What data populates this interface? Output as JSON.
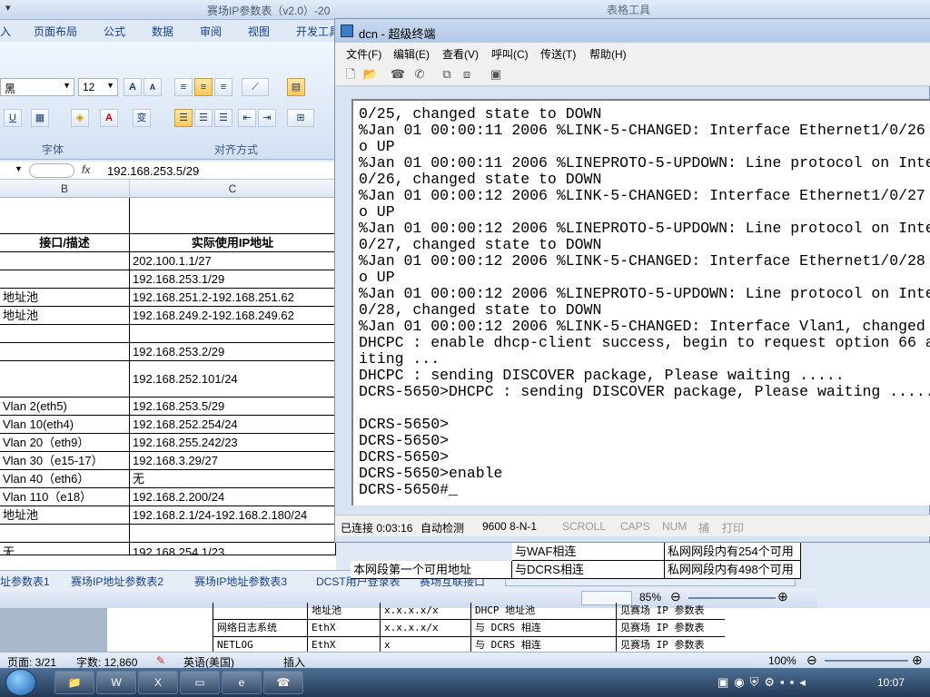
{
  "excel": {
    "title": "赛场IP参数表（v2.0）-20",
    "title_right": "表格工具",
    "quick_access": "▾",
    "ribbon_tabs": [
      "入",
      "页面布局",
      "公式",
      "数据",
      "审阅",
      "视图",
      "开发工具"
    ],
    "font_name": "黑",
    "font_size": "12",
    "group_font": "字体",
    "group_align": "对齐方式",
    "formula_fx": "fx",
    "formula_value": "192.168.253.5/29",
    "columns": [
      "B",
      "C"
    ],
    "header_b": "接口/描述",
    "header_c": "实际使用IP地址",
    "rows": [
      {
        "b": "",
        "c": "202.100.1.1/27"
      },
      {
        "b": "",
        "c": "192.168.253.1/29"
      },
      {
        "b": "地址池",
        "c": "192.168.251.2-192.168.251.62"
      },
      {
        "b": "地址池",
        "c": "192.168.249.2-192.168.249.62"
      },
      {
        "b": "",
        "c": ""
      },
      {
        "b": "",
        "c": "192.168.253.2/29"
      },
      {
        "b": "",
        "c": "192.168.252.101/24"
      },
      {
        "b": "Vlan 2(eth5)",
        "c": "192.168.253.5/29"
      },
      {
        "b": "Vlan 10(eth4)",
        "c": "192.168.252.254/24"
      },
      {
        "b": "Vlan 20（eth9）",
        "c": "192.168.255.242/23"
      },
      {
        "b": "Vlan 30（e15-17）",
        "c": "192.168.3.29/27"
      },
      {
        "b": "Vlan 40（eth6）",
        "c": "无"
      },
      {
        "b": "Vlan 110（e18）",
        "c": "192.168.2.200/24"
      },
      {
        "b": "地址池",
        "c": "192.168.2.1/24-192.168.2.180/24"
      },
      {
        "b": "",
        "c": ""
      }
    ],
    "bottom_row": {
      "b": "无",
      "c": "192.168.254.1/23",
      "d": "本网段第一个可用地址",
      "e": "与WAF相连",
      "f": "私网网段内有254个可用"
    },
    "bottom_row2": {
      "e": "与DCRS相连",
      "f": "私网网段内有498个可用"
    },
    "sheet_tabs": [
      "址参数表1",
      "赛场IP地址参数表2",
      "赛场IP地址参数表3",
      "DCST用户登录表",
      "赛场互联接口"
    ],
    "zoom": "85%"
  },
  "word": {
    "table_rows": [
      {
        "a": "",
        "b": "地址池",
        "c": "x.x.x.x/x",
        "d": "DHCP 地址池",
        "e": "见赛场 IP 参数表"
      },
      {
        "a": "网络日志系统",
        "b": "EthX",
        "c": "x.x.x.x/x",
        "d": "与 DCRS 相连",
        "e": "见赛场 IP 参数表"
      },
      {
        "a": "NETLOG",
        "b": "EthX",
        "c": "x",
        "d": "与 DCRS 相连",
        "e": "见赛场 IP 参数表"
      }
    ],
    "status_page": "页面: 3/21",
    "status_words": "字数: 12,860",
    "status_lang": "英语(美国)",
    "status_insert": "插入",
    "zoom": "100%"
  },
  "terminal": {
    "title": "dcn - 超级终端",
    "menu": [
      "文件(F)",
      "编辑(E)",
      "查看(V)",
      "呼叫(C)",
      "传送(T)",
      "帮助(H)"
    ],
    "lines": [
      "0/25, changed state to DOWN",
      "%Jan 01 00:00:11 2006 %LINK-5-CHANGED: Interface Ethernet1/0/26",
      "o UP",
      "%Jan 01 00:00:11 2006 %LINEPROTO-5-UPDOWN: Line protocol on Inte",
      "0/26, changed state to DOWN",
      "%Jan 01 00:00:12 2006 %LINK-5-CHANGED: Interface Ethernet1/0/27",
      "o UP",
      "%Jan 01 00:00:12 2006 %LINEPROTO-5-UPDOWN: Line protocol on Inte",
      "0/27, changed state to DOWN",
      "%Jan 01 00:00:12 2006 %LINK-5-CHANGED: Interface Ethernet1/0/28",
      "o UP",
      "%Jan 01 00:00:12 2006 %LINEPROTO-5-UPDOWN: Line protocol on Inte",
      "0/28, changed state to DOWN",
      "%Jan 01 00:00:12 2006 %LINK-5-CHANGED: Interface Vlan1, changed",
      "DHCPC : enable dhcp-client success, begin to request option 66 a",
      "iting ...",
      "DHCPC : sending DISCOVER package, Please waiting .....",
      "DCRS-5650>DHCPC : sending DISCOVER package, Please waiting .....",
      "",
      "DCRS-5650>",
      "DCRS-5650>",
      "DCRS-5650>",
      "DCRS-5650>enable",
      "DCRS-5650#_"
    ],
    "status": {
      "connected": "已连接 0:03:16",
      "detect": "自动检测",
      "baud": "9600 8-N-1",
      "scroll": "SCROLL",
      "caps": "CAPS",
      "num": "NUM",
      "capture": "捕",
      "print": "打印"
    }
  },
  "taskbar": {
    "clock": "10:07",
    "apps": [
      "explorer",
      "word",
      "excel",
      "cmd",
      "ie",
      "hyperterminal"
    ]
  }
}
